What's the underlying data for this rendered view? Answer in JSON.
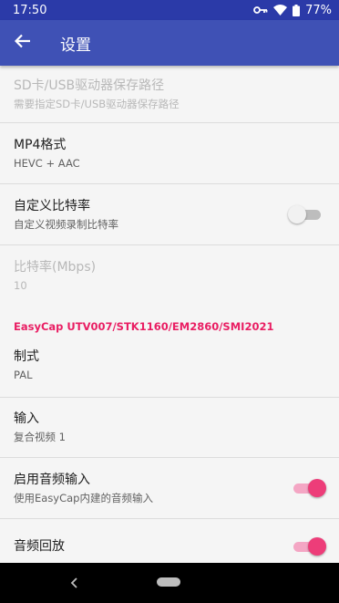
{
  "status_bar": {
    "time": "17:50",
    "battery_percent": "77%",
    "icons": [
      "key-icon",
      "wifi-icon",
      "battery-icon"
    ]
  },
  "app_bar": {
    "title": "设置",
    "background": "#3f51b5",
    "status_background": "#2b3aa8"
  },
  "preferences": {
    "storage_path": {
      "title": "SD卡/USB驱动器保存路径",
      "summary": "需要指定SD卡/USB驱动器保存路径",
      "enabled": false
    },
    "mp4_format": {
      "title": "MP4格式",
      "summary": "HEVC + AAC"
    },
    "custom_bitrate": {
      "title": "自定义比特率",
      "summary": "自定义视频录制比特率",
      "checked": false
    },
    "bitrate": {
      "title": "比特率(Mbps)",
      "summary": "10",
      "enabled": false
    },
    "category_easycap": "EasyCap UTV007/STK1160/EM2860/SMI2021",
    "standard": {
      "title": "制式",
      "summary": "PAL"
    },
    "input": {
      "title": "输入",
      "summary": "复合视频 1"
    },
    "enable_audio": {
      "title": "启用音频输入",
      "summary": "使用EasyCap内建的音频输入",
      "checked": true
    },
    "audio_playback": {
      "title": "音频回放",
      "checked": true
    }
  },
  "colors": {
    "accent": "#e91e63",
    "switch_on_thumb": "#ed3d79",
    "switch_on_track": "#f4a6c4"
  }
}
